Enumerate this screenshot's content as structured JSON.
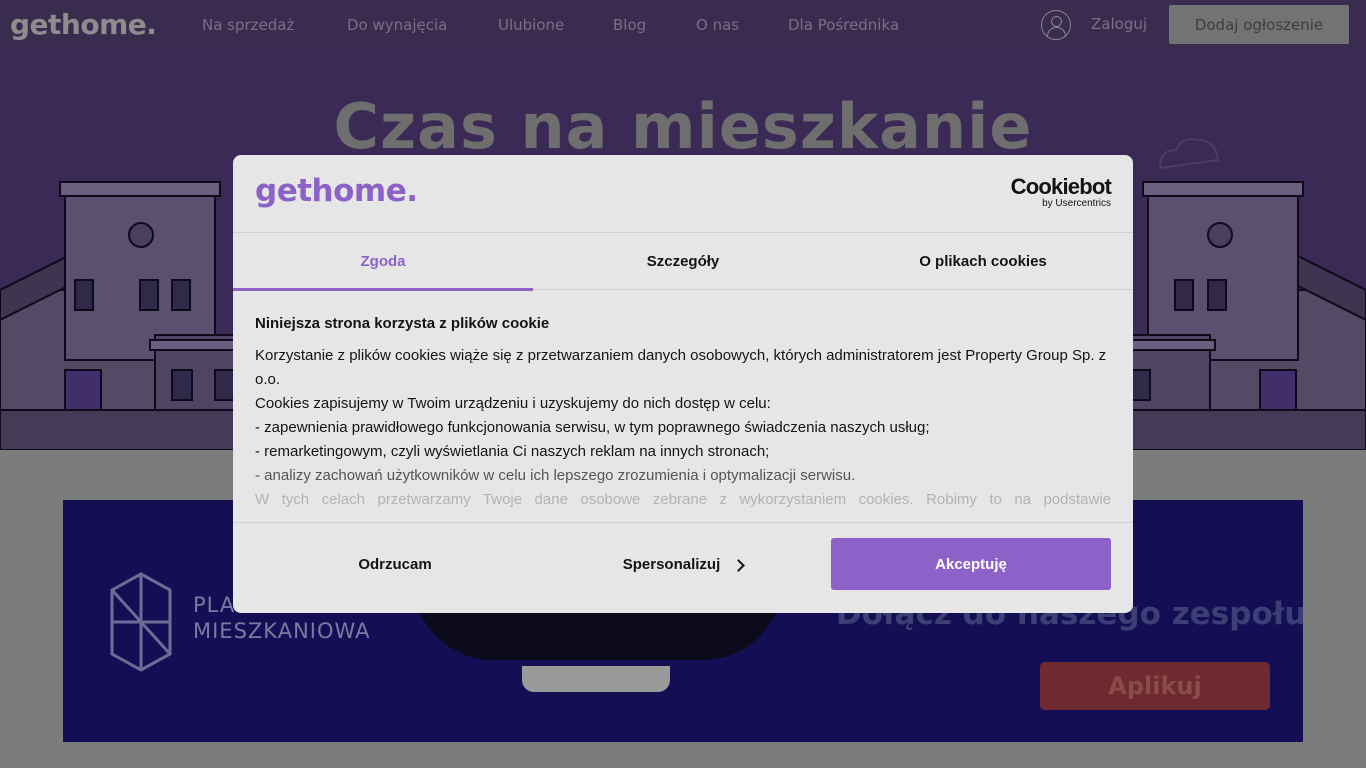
{
  "nav": {
    "logo": "gethome.",
    "links": [
      {
        "label": "Na sprzedaż"
      },
      {
        "label": "Do wynajęcia"
      },
      {
        "label": "Ulubione"
      },
      {
        "label": "Blog"
      },
      {
        "label": "O nas"
      },
      {
        "label": "Dla Pośrednika"
      }
    ],
    "login_label": "Zaloguj",
    "add_listing_label": "Dodaj ogłoszenie"
  },
  "hero": {
    "title": "Czas na mieszkanie"
  },
  "banner": {
    "brand_line1": "PLATFORMA",
    "brand_line2": "MIESZKANIOWA",
    "join_text": "Dołącz do naszego zespołu!",
    "apply_label": "Aplikuj"
  },
  "cookie_dialog": {
    "logo": "gethome.",
    "provider_name": "Cookiebot",
    "provider_sub": "by Usercentrics",
    "tabs": [
      {
        "label": "Zgoda",
        "active": true
      },
      {
        "label": "Szczegóły",
        "active": false
      },
      {
        "label": "O plikach cookies",
        "active": false
      }
    ],
    "body_title": "Niniejsza strona korzysta z plików cookie",
    "body_lines": [
      "Korzystanie z plików cookies wiąże się z przetwarzaniem danych osobowych, których administratorem jest Property Group Sp. z o.o.",
      "Cookies zapisujemy w Twoim urządzeniu i uzyskujemy do nich dostęp w celu:",
      "- zapewnienia prawidłowego funkcjonowania serwisu, w tym poprawnego świadczenia naszych usług;",
      "- remarketingowym, czyli wyświetlania Ci naszych reklam na innych stronach;",
      "- analizy zachowań użytkowników w celu ich lepszego zrozumienia i optymalizacji serwisu.",
      "W tych celach przetwarzamy Twoje dane osobowe zebrane z wykorzystaniem cookies. Robimy to na podstawie"
    ],
    "reject_label": "Odrzucam",
    "customize_label": "Spersonalizuj",
    "accept_label": "Akceptuję"
  },
  "colors": {
    "accent": "#8c62c9",
    "overlay_nav": "#3a2c4f",
    "banner_bg": "#140f55"
  }
}
